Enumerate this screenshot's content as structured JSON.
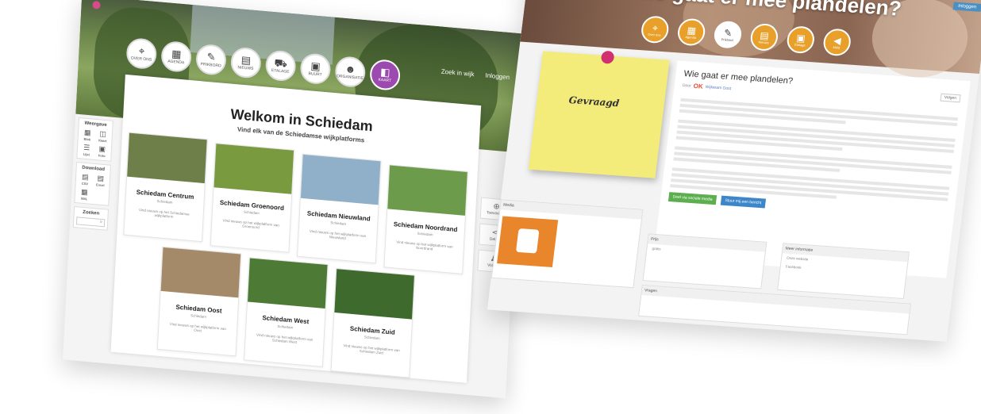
{
  "left": {
    "nav": [
      {
        "label": "OVER ONS",
        "icon": "map-pin-icon"
      },
      {
        "label": "AGENDA",
        "icon": "calendar-icon"
      },
      {
        "label": "PRIKBORD",
        "icon": "pushpin-icon"
      },
      {
        "label": "NIEUWS",
        "icon": "newspaper-icon"
      },
      {
        "label": "ETALAGE",
        "icon": "cart-icon"
      },
      {
        "label": "BUURT",
        "icon": "building-icon"
      },
      {
        "label": "ORGANISATIE",
        "icon": "people-icon"
      },
      {
        "label": "KAART",
        "icon": "map-icon"
      }
    ],
    "top_links": [
      "Zoek in wijk",
      "Inloggen"
    ],
    "sidebar": {
      "weergave_title": "Weergave",
      "weergave_items": [
        "Blok",
        "Kaart",
        "Lijst",
        "Foto"
      ],
      "download_title": "Download",
      "download_items": [
        "CSV",
        "Excel",
        "XML"
      ],
      "zoeken_title": "Zoeken"
    },
    "right_buttons": [
      "Toevoegen",
      "Delen",
      "Volgen"
    ],
    "welcome_title": "Welkom in Schiedam",
    "welcome_subtitle": "Vind elk van de Schiedamse wijkplatforms",
    "cards": [
      {
        "title": "Schiedam Centrum",
        "sub": "Schiedam",
        "desc": "Vind nieuws op het Schiedamse wijkplatform",
        "color": "#6e7f4a"
      },
      {
        "title": "Schiedam Groenoord",
        "sub": "Schiedam",
        "desc": "Vind nieuws op het wijkplatform van Groenoord",
        "color": "#7a9a3f"
      },
      {
        "title": "Schiedam Nieuwland",
        "sub": "Schiedam",
        "desc": "Vind nieuws op het wijkplatform van Nieuwland",
        "color": "#8fb0c8"
      },
      {
        "title": "Schiedam Noordrand",
        "sub": "Schiedam",
        "desc": "Vind nieuws op het wijkplatform van Noordrand",
        "color": "#6d9b4c"
      },
      {
        "title": "Schiedam Oost",
        "sub": "Schiedam",
        "desc": "Vind nieuws op het wijkplatform van Oost",
        "color": "#a58a6a"
      },
      {
        "title": "Schiedam West",
        "sub": "Schiedam",
        "desc": "Vind nieuws op het wijkplatform van Schiedam West",
        "color": "#4d7a34"
      },
      {
        "title": "Schiedam Zuid",
        "sub": "Schiedam",
        "desc": "Vind nieuws op het wijkplatform van Schiedam Zuid",
        "color": "#3f6a2e"
      }
    ]
  },
  "right": {
    "hero_title": "Wie gaat er mee plandelen?",
    "top_button": "Inloggen",
    "nav": [
      {
        "label": "Over ons",
        "icon": "map-pin-icon"
      },
      {
        "label": "Agenda",
        "icon": "calendar-icon"
      },
      {
        "label": "Prikbord",
        "icon": "pushpin-icon"
      },
      {
        "label": "Nieuws",
        "icon": "newspaper-icon"
      },
      {
        "label": "Etalage",
        "icon": "shop-icon"
      },
      {
        "label": "Meld",
        "icon": "megaphone-icon"
      }
    ],
    "postit_text": "Gevraagd",
    "post_title": "Wie gaat er mee plandelen?",
    "post_by": "Door",
    "post_org": "OK",
    "post_author": "Wijkteam Oost",
    "follow_btn": "Volgen",
    "btn_reply": "Deel via sociale media",
    "btn_contact": "Stuur mij een bericht",
    "media_title": "Media",
    "prijs_title": "Prijs",
    "prijs_value": "gratis",
    "info_title": "Meer informatie",
    "info_lines": [
      "Onze website",
      "Facebook"
    ],
    "vragen_title": "Vragen"
  }
}
